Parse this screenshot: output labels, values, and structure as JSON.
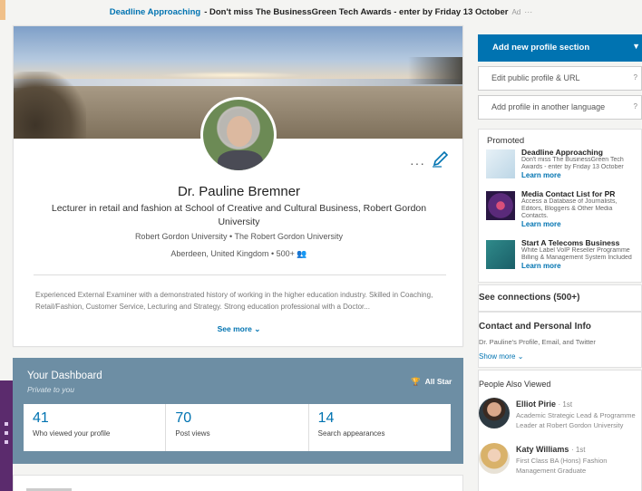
{
  "ad_bar": {
    "link": "Deadline Approaching",
    "text": "- Don't miss The BusinessGreen Tech Awards - enter by Friday 13 October",
    "tag": "Ad",
    "dots": "···"
  },
  "profile": {
    "more": "···",
    "name": "Dr. Pauline Bremner",
    "headline": "Lecturer in retail and fashion at School of Creative and Cultural Business, Robert Gordon University",
    "school": "Robert Gordon University",
    "company": "The Robert Gordon University",
    "location": "Aberdeen, United Kingdom",
    "connections": "500+",
    "summary": "Experienced External Examiner with a demonstrated history of working in the higher education industry. Skilled in Coaching, Retail/Fashion, Customer Service, Lecturing and Strategy. Strong education professional with a Doctor...",
    "see_more": "See more"
  },
  "dashboard": {
    "title": "Your Dashboard",
    "subtitle": "Private to you",
    "all_star": "All Star",
    "stats": [
      {
        "num": "41",
        "label": "Who viewed your profile"
      },
      {
        "num": "70",
        "label": "Post views"
      },
      {
        "num": "14",
        "label": "Search appearances"
      }
    ]
  },
  "sidebar": {
    "add_section": "Add new profile section",
    "edit_url": "Edit public profile & URL",
    "add_language": "Add profile in another language",
    "help": "?",
    "promoted": {
      "label": "Promoted",
      "items": [
        {
          "title": "Deadline Approaching",
          "desc1": "Don't miss The BusinessGreen Tech",
          "desc2": "Awards - enter by Friday 13 October",
          "link": "Learn more"
        },
        {
          "title": "Media Contact List for PR",
          "desc1": "Access a Database of Journalists,",
          "desc2": "Editors, Bloggers & Other Media",
          "desc3": "Contacts.",
          "link": "Learn more"
        },
        {
          "title": "Start A Telecoms Business",
          "desc1": "White Label VoIP Reseller Programme",
          "desc2": "Billing & Management System Included",
          "link": "Learn more"
        }
      ]
    },
    "connections": "See connections (500+)",
    "contact": {
      "title": "Contact and Personal Info",
      "sub": "Dr. Pauline's Profile, Email, and Twitter",
      "more": "Show more"
    },
    "people_also_viewed": {
      "title": "People Also Viewed",
      "people": [
        {
          "name": "Elliot Pirie",
          "degree": "· 1st",
          "desc": "Academic Strategic Lead & Programme Leader at Robert Gordon University"
        },
        {
          "name": "Katy Williams",
          "degree": "· 1st",
          "desc": "First Class BA (Hons) Fashion Management Graduate"
        }
      ]
    }
  }
}
